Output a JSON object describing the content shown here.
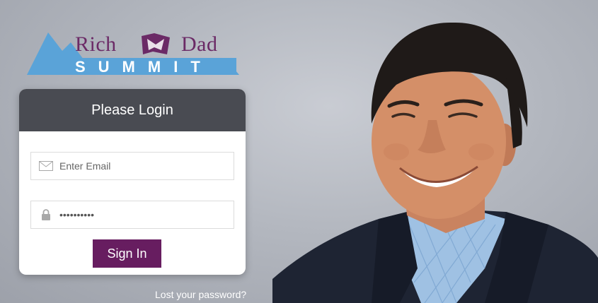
{
  "logo": {
    "word_left": "Rich",
    "word_right": "Dad",
    "registered": "®",
    "tagline": "SUMMIT",
    "colors": {
      "mountain": "#5aa3d8",
      "brand_purple": "#6b2a66"
    }
  },
  "login": {
    "title": "Please Login",
    "email_placeholder": "Enter Email",
    "password_value": "••••••••••",
    "sign_in_label": "Sign In",
    "lost_password_label": "Lost your password?",
    "icons": {
      "email": "envelope-icon",
      "password": "lock-icon"
    },
    "colors": {
      "header": "#494b52",
      "button": "#671d60"
    }
  }
}
